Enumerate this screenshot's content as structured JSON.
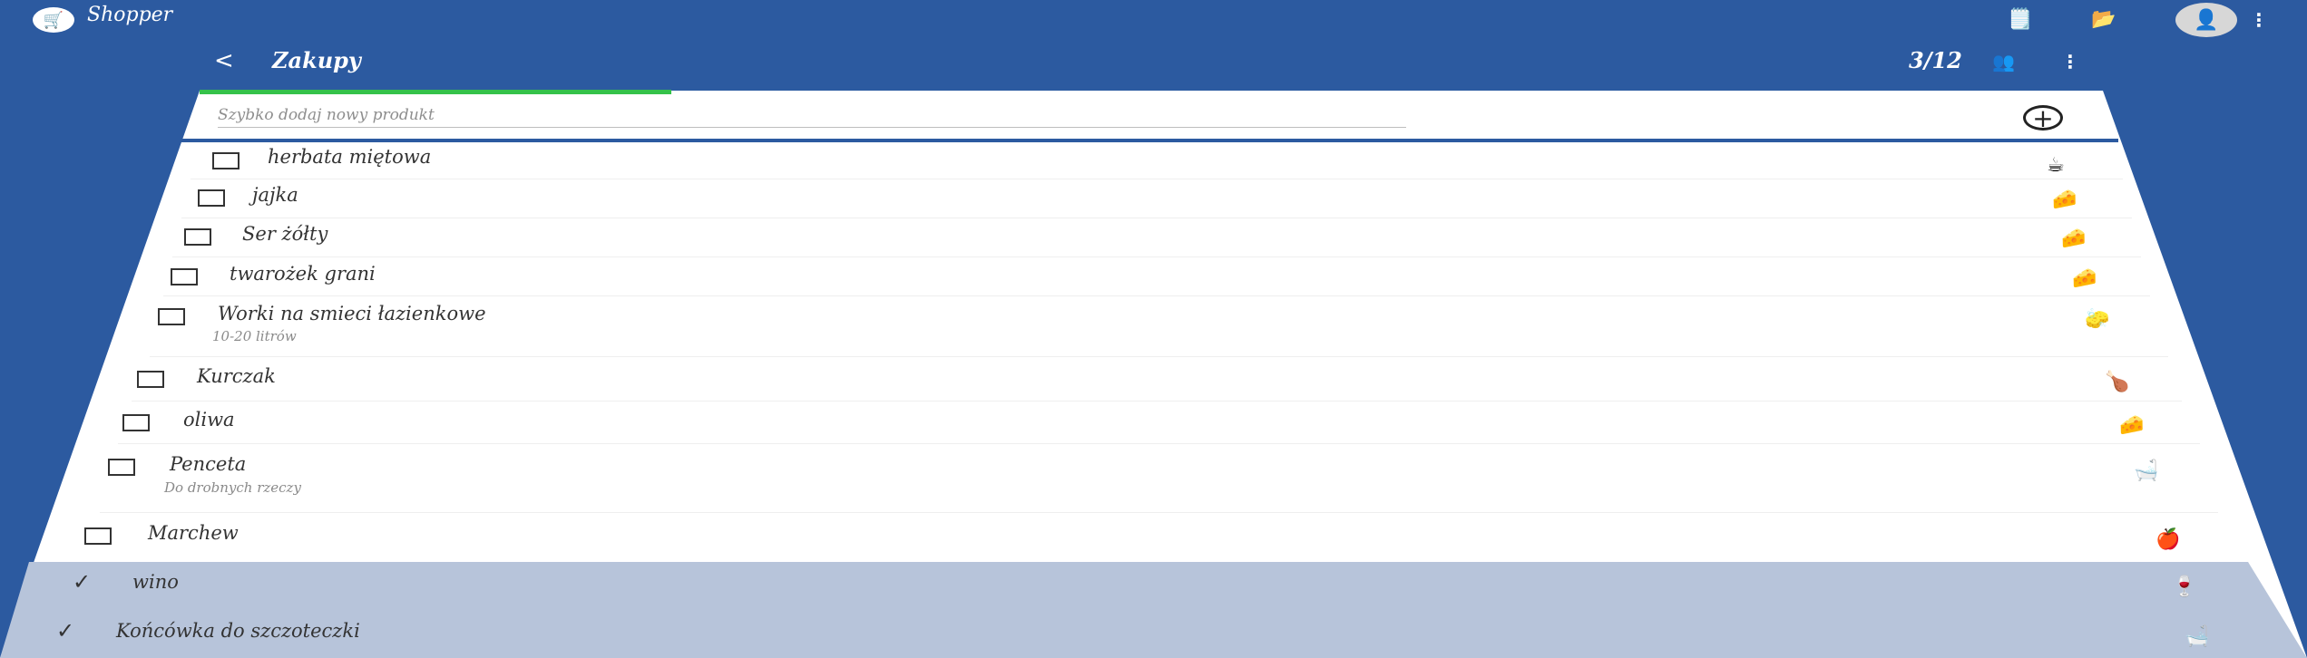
{
  "app": {
    "name": "Shopper",
    "logo_icon": "cart-logo-icon",
    "icons": [
      "notepad-icon",
      "folder-icon"
    ],
    "avatar_icon": "avatar"
  },
  "list": {
    "title": "Zakupy",
    "counter": "3/12",
    "back_icon": "back-arrow-icon",
    "share_icon": "share-users-icon",
    "menu_icon": "more-vertical-icon"
  },
  "quick_add": {
    "placeholder": "Szybko dodaj nowy produkt",
    "progress": 0.25,
    "add_icon": "add-circle-icon"
  },
  "items": [
    {
      "name": "herbata miętowa",
      "note": "",
      "category_icon": "tea-cup-icon",
      "checked": false
    },
    {
      "name": "jajka",
      "note": "",
      "category_icon": "cheese-icon",
      "checked": false
    },
    {
      "name": "Ser żółty",
      "note": "",
      "category_icon": "cheese-icon",
      "checked": false
    },
    {
      "name": "twarożek grani",
      "note": "",
      "category_icon": "cheese-icon",
      "checked": false
    },
    {
      "name": "Worki na smieci łazienkowe",
      "note": "10-20 litrów",
      "category_icon": "cleaning-icon",
      "checked": false
    },
    {
      "name": "Kurczak",
      "note": "",
      "category_icon": "meat-icon",
      "checked": false
    },
    {
      "name": "oliwa",
      "note": "",
      "category_icon": "cheese-icon",
      "checked": false
    },
    {
      "name": "Penceta",
      "note": "Do drobnych rzeczy",
      "category_icon": "bathtub-icon",
      "checked": false
    },
    {
      "name": "Marchew",
      "note": "",
      "category_icon": "apple-icon",
      "checked": false
    },
    {
      "name": "wino",
      "note": "",
      "category_icon": "wine-icon",
      "checked": true
    },
    {
      "name": "Końcówka do szczoteczki",
      "note": "",
      "category_icon": "bathtub-icon",
      "checked": true
    }
  ],
  "colors": {
    "background": "#2c5aa0",
    "progress": "#35c24a",
    "checked_area": "#b7c4da"
  }
}
